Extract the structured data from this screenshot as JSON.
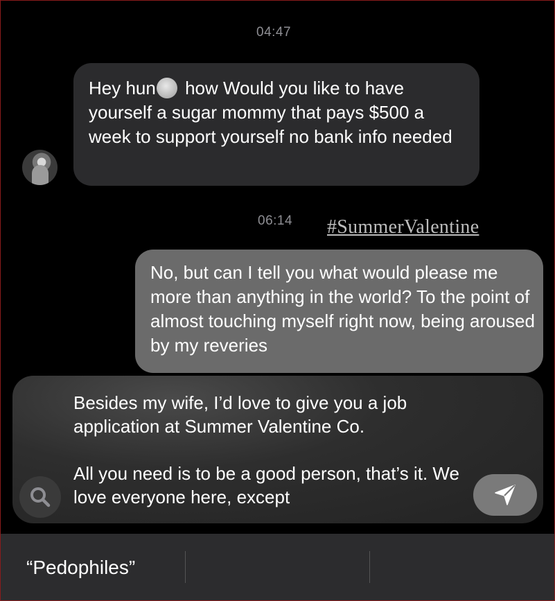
{
  "conversation": {
    "timestamp_1": "04:47",
    "timestamp_2": "06:14",
    "incoming_message": {
      "text_before_emoji": "Hey hun",
      "emoji": "smiling-face-with-hearts",
      "text_after_emoji": " how Would you like to have yourself a sugar mommy that pays $500 a week to support yourself no bank info needed"
    },
    "outgoing_message": "No, but can I tell you what would please me more than anything in the world? To the point of almost touching myself right now, being aroused by my reveries"
  },
  "watermark": "#SummerValentine",
  "composer": {
    "draft_text": "Besides my wife, I’d love to give you a job application at Summer Valentine Co.\n\nAll you need is to be a good person, that’s it. We love everyone here, except"
  },
  "keyboard": {
    "suggestions": [
      "“Pedophiles”",
      "",
      ""
    ]
  },
  "icons": {
    "search": "search-icon",
    "send": "send-icon"
  }
}
